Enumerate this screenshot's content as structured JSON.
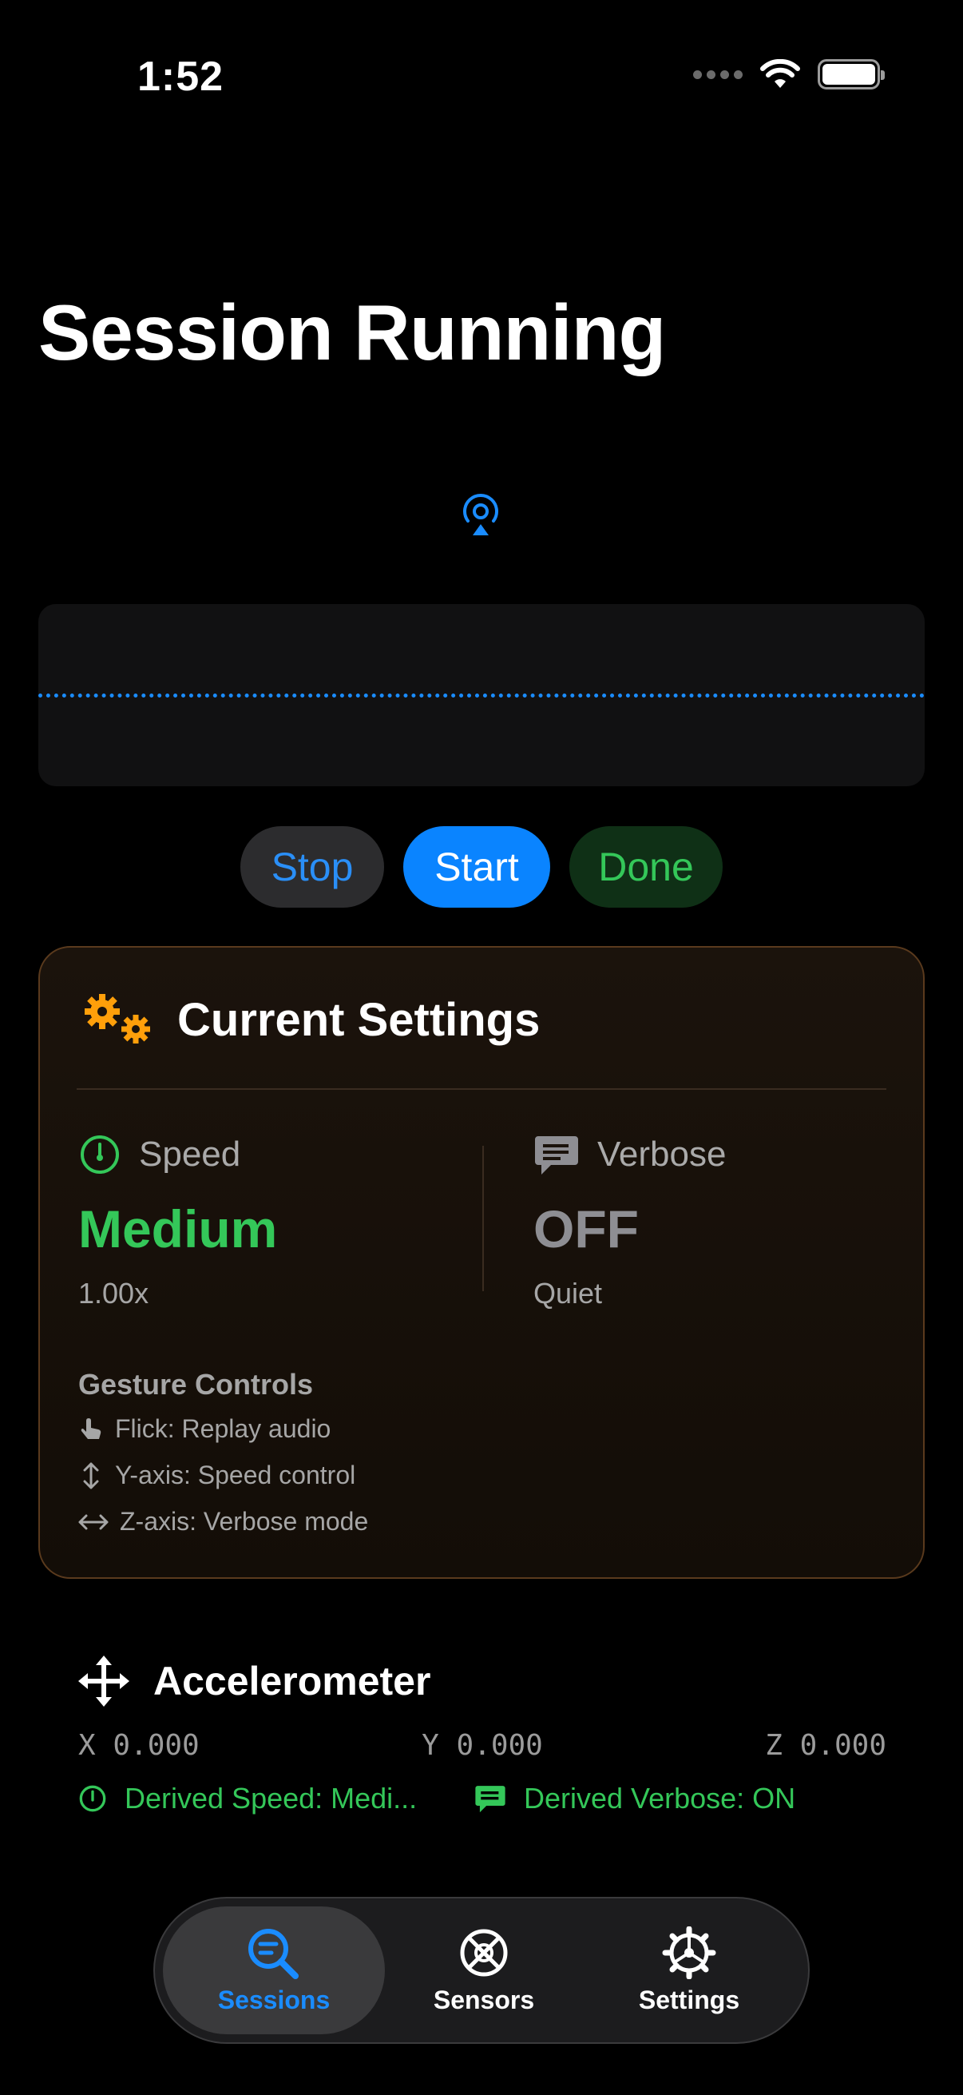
{
  "status_bar": {
    "time": "1:52"
  },
  "page_title": "Session Running",
  "controls": {
    "stop_label": "Stop",
    "start_label": "Start",
    "done_label": "Done"
  },
  "settings_card": {
    "title": "Current Settings",
    "speed": {
      "label": "Speed",
      "value": "Medium",
      "detail": "1.00x"
    },
    "verbose": {
      "label": "Verbose",
      "value": "OFF",
      "detail": "Quiet"
    },
    "gestures": {
      "title": "Gesture Controls",
      "items": [
        "Flick: Replay audio",
        "Y-axis: Speed control",
        "Z-axis: Verbose mode"
      ]
    }
  },
  "accelerometer": {
    "title": "Accelerometer",
    "x": "X 0.000",
    "y": "Y 0.000",
    "z": "Z 0.000",
    "derived_speed": "Derived Speed: Medi...",
    "derived_verbose": "Derived Verbose: ON"
  },
  "tabs": [
    {
      "label": "Sessions",
      "icon": "magnifier-icon",
      "active": true
    },
    {
      "label": "Sensors",
      "icon": "sensor-icon",
      "active": false
    },
    {
      "label": "Settings",
      "icon": "gear-icon",
      "active": false
    }
  ],
  "colors": {
    "accent_blue": "#0a84ff",
    "accent_green": "#34c759",
    "accent_orange": "#ff9f0a",
    "background": "#000000"
  }
}
